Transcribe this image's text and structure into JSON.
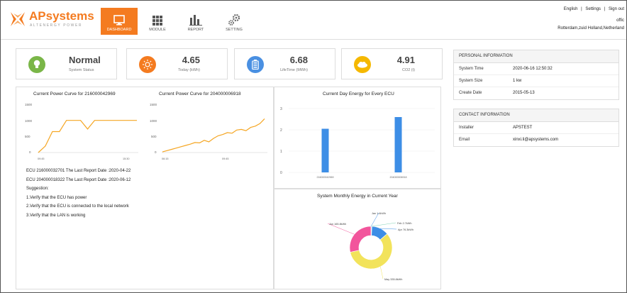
{
  "brand": {
    "name": "APsystems",
    "tagline": "ALTENERGY POWER"
  },
  "nav": [
    {
      "label": "DASHBOARD",
      "icon": "monitor-icon",
      "active": true
    },
    {
      "label": "MODULE",
      "icon": "grid-icon",
      "active": false
    },
    {
      "label": "REPORT",
      "icon": "bar-chart-icon",
      "active": false
    },
    {
      "label": "SETTING",
      "icon": "gear-icon",
      "active": false
    }
  ],
  "toplinks": {
    "language": "English",
    "settings": "Settings",
    "signout": "Sign out",
    "sep": "|"
  },
  "user": {
    "office": "offic",
    "location": "Rotterdam,zuid Holland,Netherland"
  },
  "stats": [
    {
      "value": "Normal",
      "label": "System Status",
      "color": "#7ab648"
    },
    {
      "value": "4.65",
      "label": "Today (kWh)",
      "color": "#f47b20"
    },
    {
      "value": "6.68",
      "label": "LifeTime (MWh)",
      "color": "#4a90e2"
    },
    {
      "value": "4.91",
      "label": "CO2 (t)",
      "color": "#f5b800"
    }
  ],
  "curve1": {
    "title": "Current Power Curve for 216000042969",
    "yticks": [
      "1500",
      "1000",
      "500",
      "0"
    ],
    "xticks": [
      "09:45",
      "15:30"
    ]
  },
  "curve2": {
    "title": "Current Power Curve for 204000006918",
    "yticks": [
      "1500",
      "1000",
      "500",
      "0"
    ],
    "xticks": [
      "06:15",
      "09:45"
    ]
  },
  "ecu": {
    "line1": "ECU 216000032701 The Last Report Date :2020-04-22",
    "line2": "ECU 204000018322 The Last Report Date :2020-06-12",
    "suggestion": "Suggestion:",
    "s1": "1.Verify that the ECU has power",
    "s2": "2.Verify that the ECU is connected to the local network",
    "s3": "3.Verify that the LAN is working"
  },
  "chart_data": [
    {
      "type": "line",
      "title": "Current Power Curve for 216000042969",
      "x": [
        "09:45",
        "15:30"
      ],
      "ylim": [
        0,
        1500
      ],
      "values": [
        0,
        200,
        650,
        650,
        1000,
        1000,
        1000,
        730,
        1000,
        1000,
        1000,
        1000,
        1000,
        1000,
        1000
      ],
      "color": "#f5a623"
    },
    {
      "type": "line",
      "title": "Current Power Curve for 204000006918",
      "x": [
        "06:15",
        "09:45"
      ],
      "ylim": [
        0,
        1500
      ],
      "values": [
        20,
        60,
        100,
        140,
        180,
        220,
        260,
        310,
        300,
        380,
        330,
        440,
        520,
        560,
        620,
        600,
        700,
        720,
        680,
        780,
        820,
        900,
        1050
      ],
      "color": "#f5a623"
    },
    {
      "type": "bar",
      "title": "Current Day Energy for Every ECU",
      "categories": [
        "216000042969",
        "204000006918"
      ],
      "values": [
        2.05,
        2.6
      ],
      "ylim": [
        0,
        3
      ],
      "yticks": [
        "3",
        "2",
        "1",
        "0"
      ],
      "color": "#3d8ee6"
    },
    {
      "type": "pie",
      "title": "System Monthly Energy in Current Year",
      "slices": [
        {
          "label": "Jan 1.4kWh",
          "value": 1.4,
          "color": "#3d8ee6"
        },
        {
          "label": "Feb 2.7kWh",
          "value": 2.7,
          "color": "#7fd3b5"
        },
        {
          "label": "Apr 76.3kWh",
          "value": 76.3,
          "color": "#3d8ee6"
        },
        {
          "label": "May 335.8kWh",
          "value": 335.8,
          "color": "#f2e35b"
        },
        {
          "label": "Jun 165.8kWh",
          "value": 165.8,
          "color": "#f2559c"
        }
      ]
    }
  ],
  "personal": {
    "title": "PERSONAL INFORMATION",
    "rows": [
      {
        "k": "System Time",
        "v": "2020-06-16 12:50:32"
      },
      {
        "k": "System Size",
        "v": "1 kw"
      },
      {
        "k": "Create Date",
        "v": "2015-05-13"
      }
    ]
  },
  "contact": {
    "title": "CONTACT INFORMATION",
    "rows": [
      {
        "k": "Installer",
        "v": "APSTEST"
      },
      {
        "k": "Email",
        "v": "xinxi.li@apsystems.com"
      }
    ]
  }
}
